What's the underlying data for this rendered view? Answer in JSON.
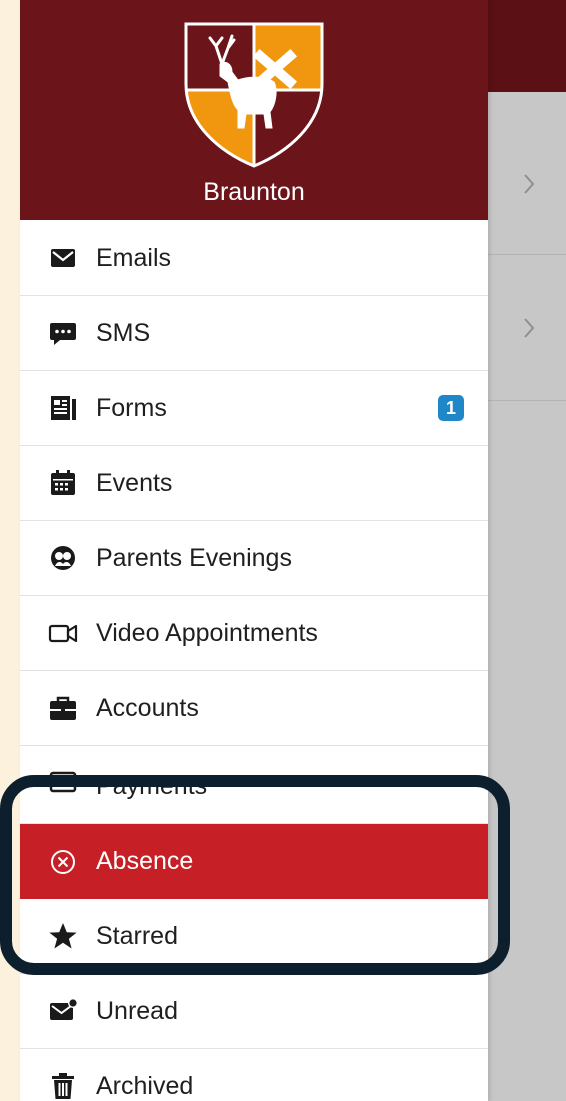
{
  "drawer": {
    "school_name": "Braunton",
    "items": [
      {
        "label": "Emails",
        "icon": "envelope-icon"
      },
      {
        "label": "SMS",
        "icon": "chat-bubble-icon"
      },
      {
        "label": "Forms",
        "icon": "forms-icon",
        "badge": "1"
      },
      {
        "label": "Events",
        "icon": "calendar-icon"
      },
      {
        "label": "Parents Evenings",
        "icon": "parents-evening-icon"
      },
      {
        "label": "Video Appointments",
        "icon": "video-camera-icon"
      },
      {
        "label": "Accounts",
        "icon": "briefcase-icon"
      },
      {
        "label": "Payments",
        "icon": "payment-card-icon"
      },
      {
        "label": "Absence",
        "icon": "circle-x-icon",
        "active": true
      },
      {
        "label": "Starred",
        "icon": "star-icon"
      },
      {
        "label": "Unread",
        "icon": "unread-mail-icon"
      },
      {
        "label": "Archived",
        "icon": "trash-icon"
      }
    ]
  },
  "colors": {
    "header_bg": "#6b141a",
    "topbar_bg": "#5a1014",
    "crest_gold": "#f0970f",
    "active_bg": "#c62026",
    "badge_bg": "#1f87c7",
    "highlight_border": "#0d1f2d",
    "page_bg": "#fbf1dc"
  }
}
